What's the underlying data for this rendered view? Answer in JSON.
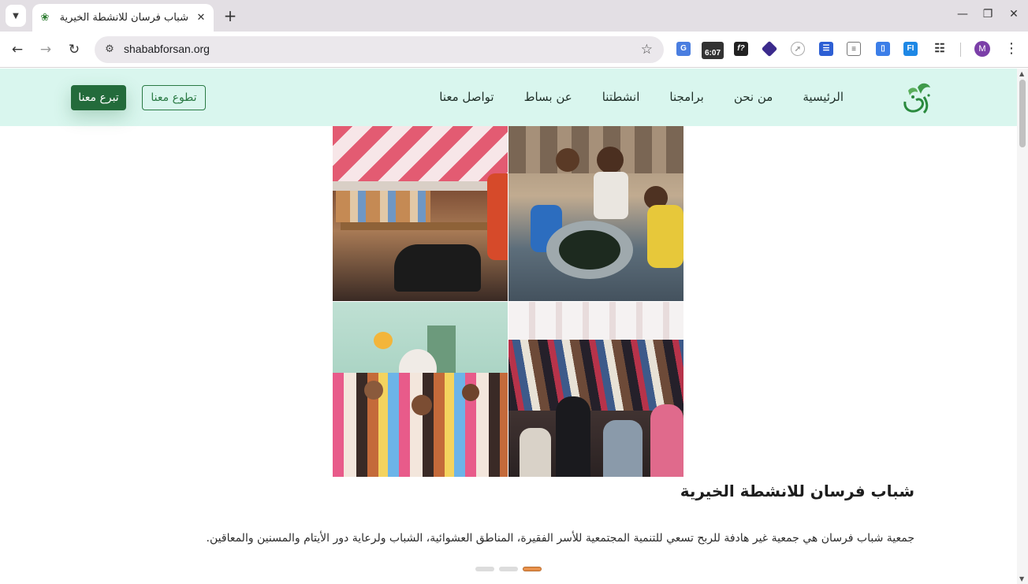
{
  "browser": {
    "tab_title": "شباب فرسان للانشطة الخيرية",
    "url": "shababforsan.org",
    "extension_badge": "6:07",
    "profile_initial": "M"
  },
  "site": {
    "nav": [
      "الرئيسية",
      "من نحن",
      "برامجنا",
      "انشطتنا",
      "عن بساط",
      "تواصل معنا"
    ],
    "volunteer_label": "تطوع معنا",
    "donate_label": "تبرع معنا",
    "accent_color": "#236b3b",
    "header_bg": "#d9f6ee"
  },
  "hero": {
    "title": "شباب فرسان للانشطة الخيرية",
    "description": "جمعية شباب فرسان هي جمعية غير هادفة للربح تسعي للتنمية المجتمعية للأسر الفقيرة، المناطق العشوائية، الشباب ولرعاية دور الأيتام والمسنين والمعاقين.",
    "slides_total": 3,
    "active_slide": 3
  }
}
